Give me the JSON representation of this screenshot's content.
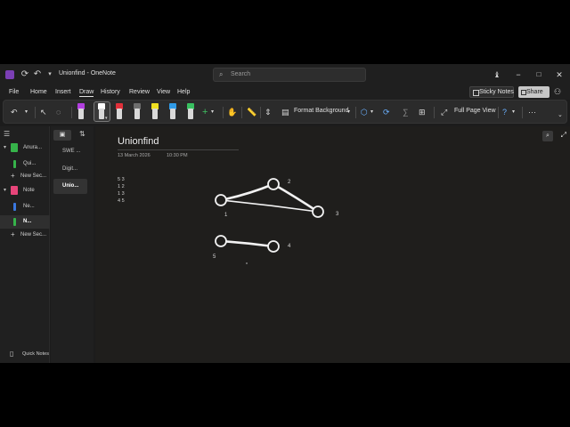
{
  "window": {
    "title": "Unionfind",
    "app_name": "OneNote",
    "title_separator": "-",
    "controls": {
      "minimize": "−",
      "maximize": "□",
      "close": "✕"
    }
  },
  "search": {
    "placeholder": "Search"
  },
  "menu": {
    "items": [
      "File",
      "Home",
      "Insert",
      "Draw",
      "History",
      "Review",
      "View",
      "Help"
    ],
    "active": "Draw",
    "sticky_notes": "Sticky Notes",
    "share": "Share"
  },
  "ribbon": {
    "format_background": "Format Background",
    "full_page_view": "Full Page View",
    "pen_colors": [
      "#b33fe0",
      "#ffffff",
      "#e0303a",
      "#6e6e6e",
      "#f0e020",
      "#2f9be8",
      "#38c060"
    ]
  },
  "notebooks": [
    {
      "label": "Anura...",
      "color": "#36b34a",
      "expanded": true,
      "sections": [
        {
          "label": "Qui...",
          "color": "#36b34a"
        }
      ]
    },
    {
      "label": "Note",
      "color": "#e8457a",
      "expanded": true,
      "sections": [
        {
          "label": "Ne...",
          "color": "#3a78e0"
        },
        {
          "label": "N...",
          "color": "#36b34a",
          "selected": true
        }
      ]
    }
  ],
  "new_section_label": "New Sec...",
  "quick_notes": "Quick Notes",
  "pages": [
    "SWE ...",
    "Digit...",
    "Unio..."
  ],
  "active_page_index": 2,
  "page": {
    "title": "Unionfind",
    "date": "13 March 2026",
    "time": "10:30 PM",
    "lines": [
      "5 3",
      "1 2",
      "1 3",
      "4 5"
    ]
  },
  "graph": {
    "nodes": [
      {
        "id": "1",
        "label": "1"
      },
      {
        "id": "2",
        "label": "2"
      },
      {
        "id": "3",
        "label": "3"
      },
      {
        "id": "4",
        "label": "4"
      },
      {
        "id": "5",
        "label": "5"
      }
    ],
    "edges": [
      [
        "1",
        "2"
      ],
      [
        "2",
        "3"
      ],
      [
        "1",
        "3"
      ],
      [
        "5",
        "4"
      ]
    ],
    "stroke_color": "#f2f2f2"
  },
  "colors": {
    "accent": "#7b3fb5",
    "background": "#1f1e1c",
    "chrome": "#1f1f1f"
  }
}
